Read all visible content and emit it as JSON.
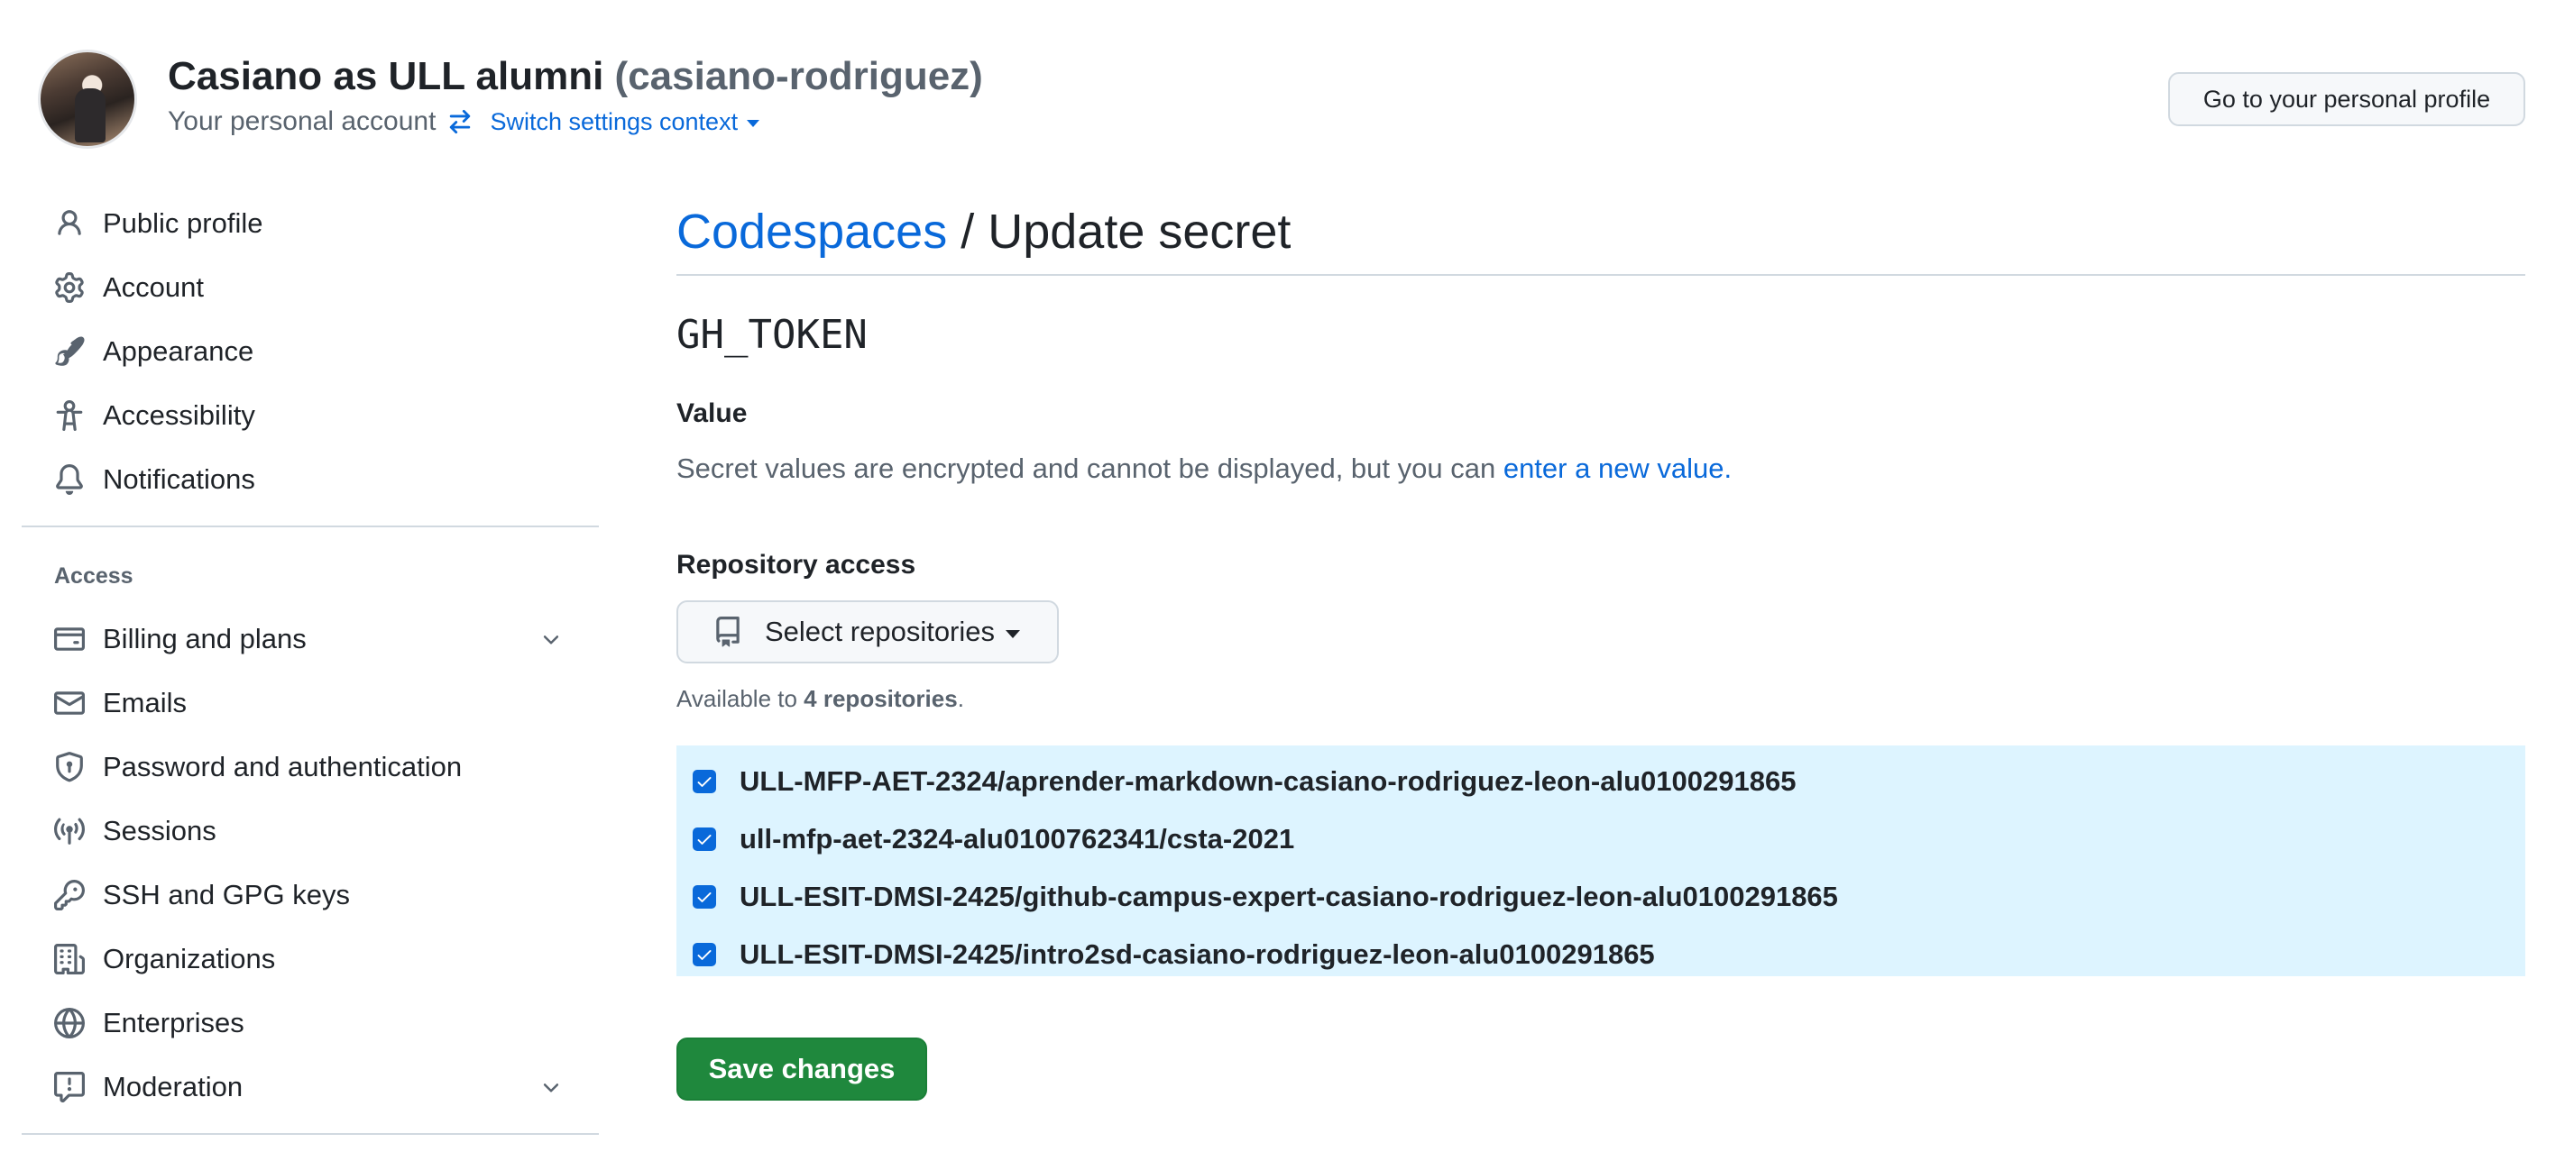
{
  "header": {
    "account_name": "Casiano as ULL alumni",
    "handle": "(casiano-rodriguez)",
    "subtitle": "Your personal account",
    "switch_context": "Switch settings context",
    "profile_button": "Go to your personal profile"
  },
  "sidebar": {
    "items_top": [
      {
        "label": "Public profile",
        "icon": "person-icon"
      },
      {
        "label": "Account",
        "icon": "gear-icon"
      },
      {
        "label": "Appearance",
        "icon": "paintbrush-icon"
      },
      {
        "label": "Accessibility",
        "icon": "accessibility-icon"
      },
      {
        "label": "Notifications",
        "icon": "bell-icon"
      }
    ],
    "access_heading": "Access",
    "items_access": [
      {
        "label": "Billing and plans",
        "icon": "credit-card-icon",
        "expandable": true
      },
      {
        "label": "Emails",
        "icon": "mail-icon"
      },
      {
        "label": "Password and authentication",
        "icon": "shield-lock-icon"
      },
      {
        "label": "Sessions",
        "icon": "broadcast-icon"
      },
      {
        "label": "SSH and GPG keys",
        "icon": "key-icon"
      },
      {
        "label": "Organizations",
        "icon": "organization-icon"
      },
      {
        "label": "Enterprises",
        "icon": "globe-icon"
      },
      {
        "label": "Moderation",
        "icon": "report-icon",
        "expandable": true
      }
    ]
  },
  "main": {
    "breadcrumb_link": "Codespaces",
    "breadcrumb_sep": " / ",
    "title": "Update secret",
    "secret_name": "GH_TOKEN",
    "value_label": "Value",
    "value_note": "Secret values are encrypted and cannot be displayed, but you can ",
    "value_note_link": "enter a new value.",
    "repo_access_label": "Repository access",
    "select_button": "Select repositories",
    "available_prefix": "Available to ",
    "available_count": "4 repositories",
    "available_suffix": ".",
    "repositories": [
      {
        "name": "ULL-MFP-AET-2324/aprender-markdown-casiano-rodriguez-leon-alu0100291865",
        "checked": true
      },
      {
        "name": "ull-mfp-aet-2324-alu0100762341/csta-2021",
        "checked": true
      },
      {
        "name": "ULL-ESIT-DMSI-2425/github-campus-expert-casiano-rodriguez-leon-alu0100291865",
        "checked": true
      },
      {
        "name": "ULL-ESIT-DMSI-2425/intro2sd-casiano-rodriguez-leon-alu0100291865",
        "checked": true
      }
    ],
    "save_button": "Save changes"
  },
  "colors": {
    "link": "#0969da",
    "primary_button": "#1f883d",
    "selected_row_bg": "#ddf4ff",
    "muted_text": "#59636e"
  }
}
